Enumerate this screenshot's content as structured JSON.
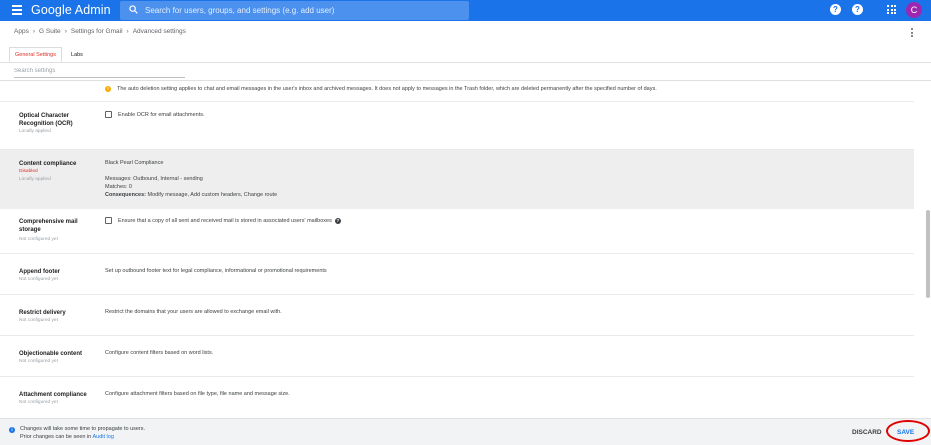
{
  "header": {
    "brand": "Google Admin",
    "search_placeholder": "Search for users, groups, and settings (e.g. add user)",
    "help_glyph": "?",
    "support_glyph": "?",
    "avatar_initial": "C",
    "accent_color": "#1a73e8"
  },
  "breadcrumb": {
    "items": [
      "Apps",
      "G Suite",
      "Settings for Gmail",
      "Advanced settings"
    ],
    "separator": "›"
  },
  "tabs": [
    {
      "label": "General Settings",
      "active": true
    },
    {
      "label": "Labs",
      "active": false
    }
  ],
  "search_settings_placeholder": "Search settings",
  "info_banner": "The auto deletion setting applies to chat and email messages in the user's inbox and archived messages. It does not apply to messages in the Trash folder, which are deleted permanently after the specified number of days.",
  "rows": {
    "ocr": {
      "title": "Optical Character Recognition (OCR)",
      "status": "Locally applied",
      "checkbox_label": "Enable OCR for email attachments."
    },
    "content_compliance": {
      "title": "Content compliance",
      "status": "Disabled",
      "status2": "Locally applied",
      "rule_name": "Black Pearl Compliance",
      "messages_label": "Messages:",
      "messages_value": "Outbound, Internal - sending",
      "matches_label": "Matches:",
      "matches_value": "0",
      "consequences_label": "Consequences:",
      "consequences_value": "Modify message, Add custom headers, Change route"
    },
    "comprehensive_storage": {
      "title": "Comprehensive mail storage",
      "status": "Not configured yet",
      "checkbox_label": "Ensure that a copy of all sent and received mail is stored in associated users' mailboxes"
    },
    "append_footer": {
      "title": "Append footer",
      "status": "Not configured yet",
      "desc": "Set up outbound footer text for legal compliance, informational or promotional requirements"
    },
    "restrict_delivery": {
      "title": "Restrict delivery",
      "status": "Not configured yet",
      "desc": "Restrict the domains that your users are allowed to exchange email with."
    },
    "objectionable_content": {
      "title": "Objectionable content",
      "status": "Not configured yet",
      "desc": "Configure content filters based on word lists."
    },
    "attachment_compliance": {
      "title": "Attachment compliance",
      "status": "Not configured yet",
      "desc": "Configure attachment filters based on file type, file name and message size."
    }
  },
  "footer": {
    "line1": "Changes will take some time to propagate to users.",
    "line2_prefix": "Prior changes can be seen in",
    "audit_log_link": "Audit log",
    "discard_label": "DISCARD",
    "save_label": "SAVE"
  }
}
